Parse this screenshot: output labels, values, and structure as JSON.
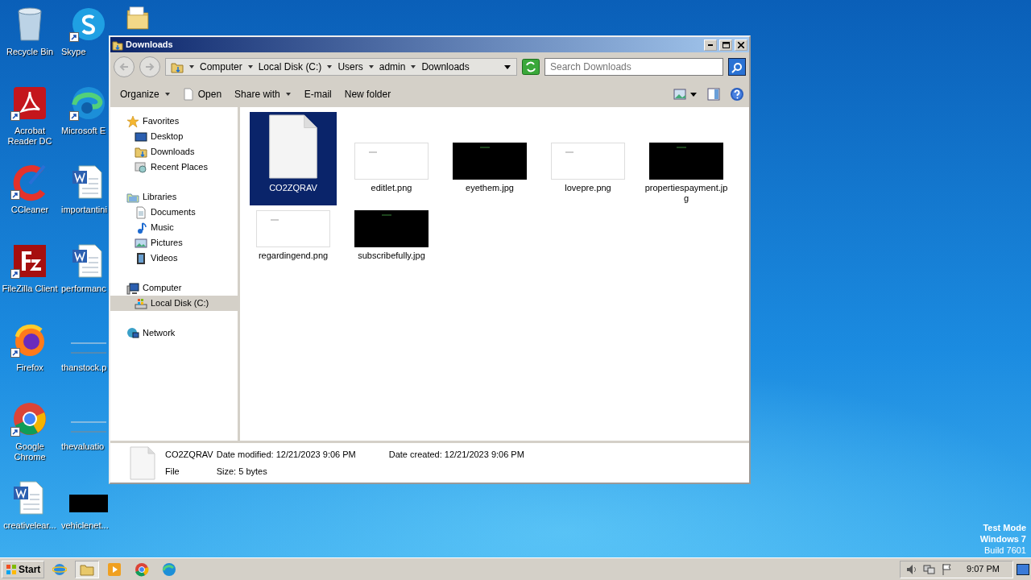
{
  "desktop": {
    "columns": [
      [
        {
          "label": "Recycle Bin",
          "kind": "recycle"
        },
        {
          "label": "Acrobat Reader DC",
          "kind": "acrobat",
          "shortcut": true
        },
        {
          "label": "CCleaner",
          "kind": "ccleaner",
          "shortcut": true
        },
        {
          "label": "FileZilla Client",
          "kind": "filezilla",
          "shortcut": true
        },
        {
          "label": "Firefox",
          "kind": "firefox",
          "shortcut": true
        },
        {
          "label": "Google Chrome",
          "kind": "chrome",
          "shortcut": true
        },
        {
          "label": "creativelear...",
          "kind": "word"
        }
      ],
      [
        {
          "label": "Skype",
          "kind": "skype",
          "shortcut": true
        },
        {
          "label": "Microsoft E",
          "kind": "edge",
          "shortcut": true
        },
        {
          "label": "importantini",
          "kind": "word"
        },
        {
          "label": "performanc",
          "kind": "word"
        },
        {
          "label": "thanstock.p",
          "kind": "thumb_light"
        },
        {
          "label": "thevaluatio",
          "kind": "thumb_light"
        },
        {
          "label": "vehiclenet...",
          "kind": "thumb_dark"
        }
      ],
      [
        {
          "kind": "folder"
        }
      ]
    ]
  },
  "window": {
    "title": "Downloads",
    "breadcrumb": [
      "Computer",
      "Local Disk (C:)",
      "Users",
      "admin",
      "Downloads"
    ],
    "search": {
      "placeholder": "Search Downloads"
    },
    "toolbar": [
      {
        "label": "Organize",
        "kind": "menu"
      },
      {
        "label": "Open",
        "kind": "file"
      },
      {
        "label": "Share with",
        "kind": "menu"
      },
      {
        "label": "E-mail",
        "kind": "plain"
      },
      {
        "label": "New folder",
        "kind": "plain"
      }
    ],
    "nav": [
      {
        "label": "Favorites",
        "kind": "star",
        "selected": false,
        "children": [
          {
            "label": "Desktop",
            "kind": "desktop",
            "selected": false
          },
          {
            "label": "Downloads",
            "kind": "downloads",
            "selected": false
          },
          {
            "label": "Recent Places",
            "kind": "recent",
            "selected": false
          }
        ]
      },
      {
        "label": "Libraries",
        "kind": "library",
        "selected": false,
        "children": [
          {
            "label": "Documents",
            "kind": "documents",
            "selected": false
          },
          {
            "label": "Music",
            "kind": "music",
            "selected": false
          },
          {
            "label": "Pictures",
            "kind": "pictures",
            "selected": false
          },
          {
            "label": "Videos",
            "kind": "videos",
            "selected": false
          }
        ]
      },
      {
        "label": "Computer",
        "kind": "computer",
        "selected": false,
        "children": [
          {
            "label": "Local Disk (C:)",
            "kind": "disk",
            "selected": true
          }
        ]
      },
      {
        "label": "Network",
        "kind": "network",
        "selected": false
      }
    ],
    "files": [
      {
        "name": "CO2ZQRAV",
        "kind": "file",
        "selected": true
      },
      {
        "name": "editlet.png",
        "kind": "light",
        "selected": false
      },
      {
        "name": "eyethem.jpg",
        "kind": "dark",
        "selected": false
      },
      {
        "name": "lovepre.png",
        "kind": "light",
        "selected": false
      },
      {
        "name": "propertiespayment.jpg",
        "kind": "dark",
        "selected": false
      },
      {
        "name": "regardingend.png",
        "kind": "light",
        "selected": false
      },
      {
        "name": "subscribefully.jpg",
        "kind": "dark",
        "selected": false
      }
    ],
    "details": {
      "name": "CO2ZQRAV",
      "type": "File",
      "fields": [
        {
          "label": "Date modified:",
          "value": "12/21/2023 9:06 PM"
        },
        {
          "label": "Date created:",
          "value": "12/21/2023 9:06 PM"
        },
        {
          "label": "Size:",
          "value": "5 bytes"
        }
      ]
    }
  },
  "system_notice": [
    "Test Mode",
    "Windows 7",
    "Build 7601"
  ],
  "taskbar": {
    "start": "Start",
    "apps": [
      {
        "kind": "ie",
        "active": false
      },
      {
        "kind": "explorer",
        "active": true
      },
      {
        "kind": "media",
        "active": false
      },
      {
        "kind": "chrome",
        "active": false
      },
      {
        "kind": "edge",
        "active": false
      }
    ],
    "tray": [
      {
        "kind": "volume"
      },
      {
        "kind": "network"
      },
      {
        "kind": "flag"
      }
    ],
    "clock": "9:07 PM"
  }
}
